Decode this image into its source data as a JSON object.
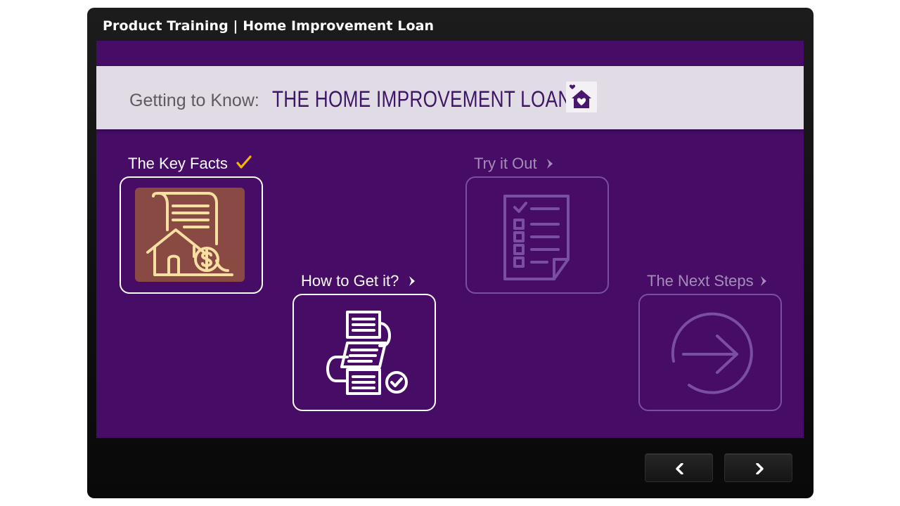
{
  "player": {
    "title": "Product Training | Home Improvement Loan"
  },
  "banner": {
    "lead": "Getting to Know:",
    "title": "THE HOME IMPROVEMENT LOAN",
    "icon": "house-heart-icon"
  },
  "tiles": [
    {
      "label": "The Key Facts",
      "status": "completed",
      "marker": "checkmark-icon",
      "icon": "loan-document-house-dollar-icon"
    },
    {
      "label": "How to Get it?",
      "status": "available",
      "marker": "chevron-right-icon",
      "icon": "process-flow-icon"
    },
    {
      "label": "Try it Out",
      "status": "locked",
      "marker": "chevron-right-icon",
      "icon": "checklist-icon"
    },
    {
      "label": "The Next Steps",
      "status": "locked",
      "marker": "chevron-right-icon",
      "icon": "arrow-circle-right-icon"
    }
  ],
  "navigation": {
    "prev_icon": "chevron-left-icon",
    "next_icon": "chevron-right-icon"
  },
  "colors": {
    "stage": "#460c66",
    "banner": "#e0dbe5",
    "banner_title": "#3f1566",
    "check": "#f5b800",
    "key_facts_tile_fill": "#8a4a44",
    "key_facts_tile_art": "#f6dfa0",
    "locked": "#7a4ea0"
  }
}
